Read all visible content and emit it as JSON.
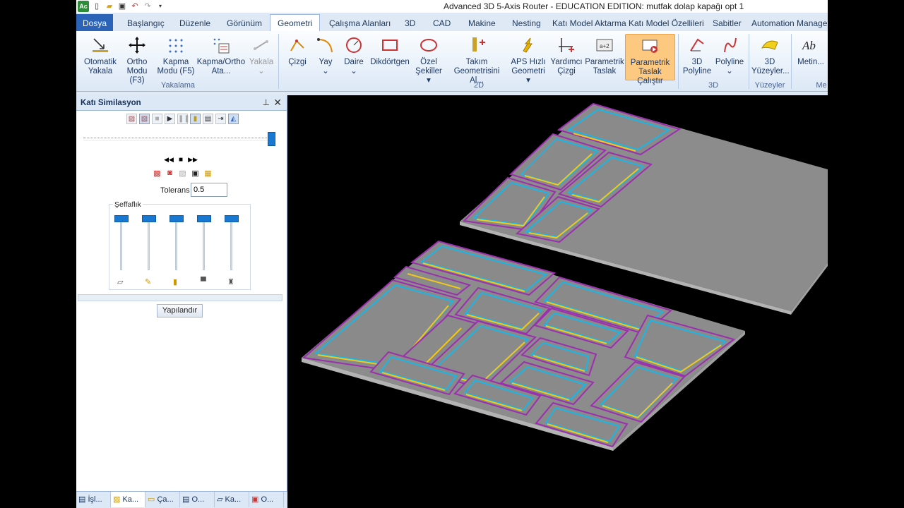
{
  "window": {
    "title": "Advanced 3D 5-Axis Router - EDUCATION EDITION: mutfak dolap kapağı opt 1",
    "app_badge": "Ac"
  },
  "quick_access": {
    "icons": [
      "new-file-icon",
      "open-folder-icon",
      "save-icon",
      "undo-icon",
      "redo-icon",
      "dropdown-icon"
    ]
  },
  "tabs": {
    "file": "Dosya",
    "items": [
      "Başlangıç",
      "Düzenle",
      "Görünüm",
      "Geometri",
      "Çalışma Alanları",
      "3D",
      "CAD",
      "Makine",
      "Nesting",
      "Katı Model Aktarma",
      "Katı Model Özellileri",
      "Sabitler",
      "Automation Manage"
    ],
    "active": "Geometri"
  },
  "ribbon": {
    "yakalama": {
      "label": "Yakalama",
      "buttons": [
        {
          "line1": "Otomatik",
          "line2": "Yakala"
        },
        {
          "line1": "Ortho",
          "line2": "Modu (F3)"
        },
        {
          "line1": "Kapma",
          "line2": "Modu (F5)"
        },
        {
          "line1": "Kapma/Ortho",
          "line2": "Ata..."
        },
        {
          "line1": "Yakala",
          "line2": ""
        }
      ]
    },
    "d2": {
      "label": "2D",
      "buttons": [
        {
          "line1": "Çizgi",
          "line2": ""
        },
        {
          "line1": "Yay",
          "line2": ""
        },
        {
          "line1": "Daire",
          "line2": ""
        },
        {
          "line1": "Dikdörtgen",
          "line2": ""
        },
        {
          "line1": "Özel",
          "line2": "Şekiller"
        },
        {
          "line1": "Takım",
          "line2": "Geometrisini Al..."
        },
        {
          "line1": "APS Hızlı",
          "line2": "Geometri"
        },
        {
          "line1": "Yardımcı",
          "line2": "Çizgi"
        },
        {
          "line1": "Parametrik",
          "line2": "Taslak"
        },
        {
          "line1": "Parametrik",
          "line2": "Taslak Çalıştır"
        }
      ]
    },
    "d3": {
      "label": "3D",
      "buttons": [
        {
          "line1": "3D",
          "line2": "Polyline"
        },
        {
          "line1": "Polyline",
          "line2": ""
        }
      ]
    },
    "yuzeyler": {
      "label": "Yüzeyler",
      "buttons": [
        {
          "line1": "3D",
          "line2": "Yüzeyler..."
        }
      ]
    },
    "metin": {
      "label": "Me",
      "buttons": [
        {
          "line1": "Metin...",
          "line2": ""
        }
      ]
    }
  },
  "panel": {
    "title": "Katı Similasyon",
    "tolerans_label": "Tolerans",
    "tolerans_value": "0.5",
    "seffaflik_label": "Şeffaflık",
    "configure_button": "Yapılandır",
    "sim_slider_fraction": 1.0,
    "transparency_levels": [
      1.0,
      1.0,
      1.0,
      1.0,
      1.0
    ],
    "bottom_tabs": [
      "İşl...",
      "Ka...",
      "Ça...",
      "O...",
      "Ka...",
      "O..."
    ],
    "bottom_tab_selected": "Ka..."
  },
  "viewport": {
    "colors": {
      "background": "#000000",
      "board": "#8c8c8c",
      "stock": "#9a9a9a",
      "edge": "#b0b0b0",
      "outline_purple": "#9b2fae",
      "outline_cyan": "#19b6e6",
      "outline_yellow": "#f2c81b"
    }
  }
}
